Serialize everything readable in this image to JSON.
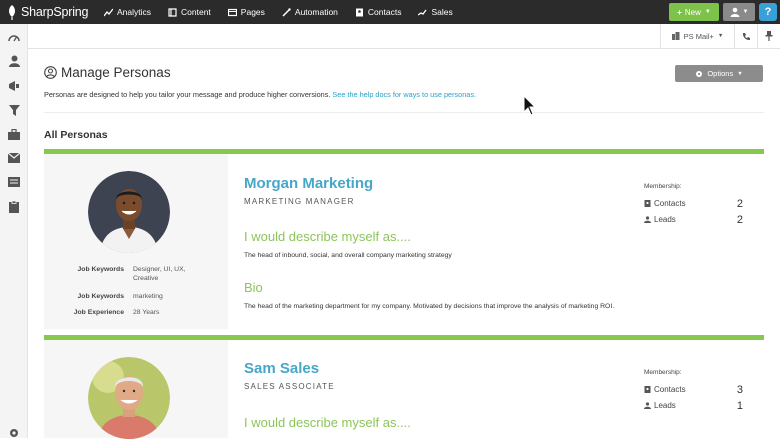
{
  "nav": {
    "brand": "SharpSpring",
    "items": [
      {
        "label": "Analytics",
        "icon": "chart-icon"
      },
      {
        "label": "Content",
        "icon": "content-icon"
      },
      {
        "label": "Pages",
        "icon": "pages-icon"
      },
      {
        "label": "Automation",
        "icon": "automation-icon"
      },
      {
        "label": "Contacts",
        "icon": "contacts-icon"
      },
      {
        "label": "Sales",
        "icon": "sales-icon"
      }
    ],
    "new_label": "New",
    "help_label": "?"
  },
  "subbar": {
    "mail_label": "PS Mail+"
  },
  "page": {
    "title": "Manage Personas",
    "intro_text": "Personas are designed to help you tailor your message and produce higher conversions.",
    "intro_link": "See the help docs for ways to use personas.",
    "options_label": "Options",
    "section_title": "All Personas"
  },
  "personas": [
    {
      "name": "Morgan Marketing",
      "role": "MARKETING MANAGER",
      "describe_heading": "I would describe myself as....",
      "describe_text": "The head of inbound, social, and overall company marketing strategy",
      "bio_heading": "Bio",
      "bio_text": "The head of the marketing department for my company. Motivated by decisions that improve the analysis of marketing ROI.",
      "fields": [
        {
          "key": "Job Keywords",
          "value": "Designer, UI, UX, Creative"
        },
        {
          "key": "Job Keywords",
          "value": "marketing"
        },
        {
          "key": "Job Experience",
          "value": "28 Years"
        }
      ],
      "membership_label": "Membership:",
      "contacts_label": "Contacts",
      "contacts_count": "2",
      "leads_label": "Leads",
      "leads_count": "2"
    },
    {
      "name": "Sam Sales",
      "role": "SALES ASSOCIATE",
      "describe_heading": "I would describe myself as....",
      "membership_label": "Membership:",
      "contacts_label": "Contacts",
      "contacts_count": "3",
      "leads_label": "Leads",
      "leads_count": "1"
    }
  ],
  "colors": {
    "accent_green": "#86c94e",
    "name_blue": "#47a7c9",
    "link_blue": "#2aa0c8",
    "nav_bg": "#2b2b2b"
  }
}
